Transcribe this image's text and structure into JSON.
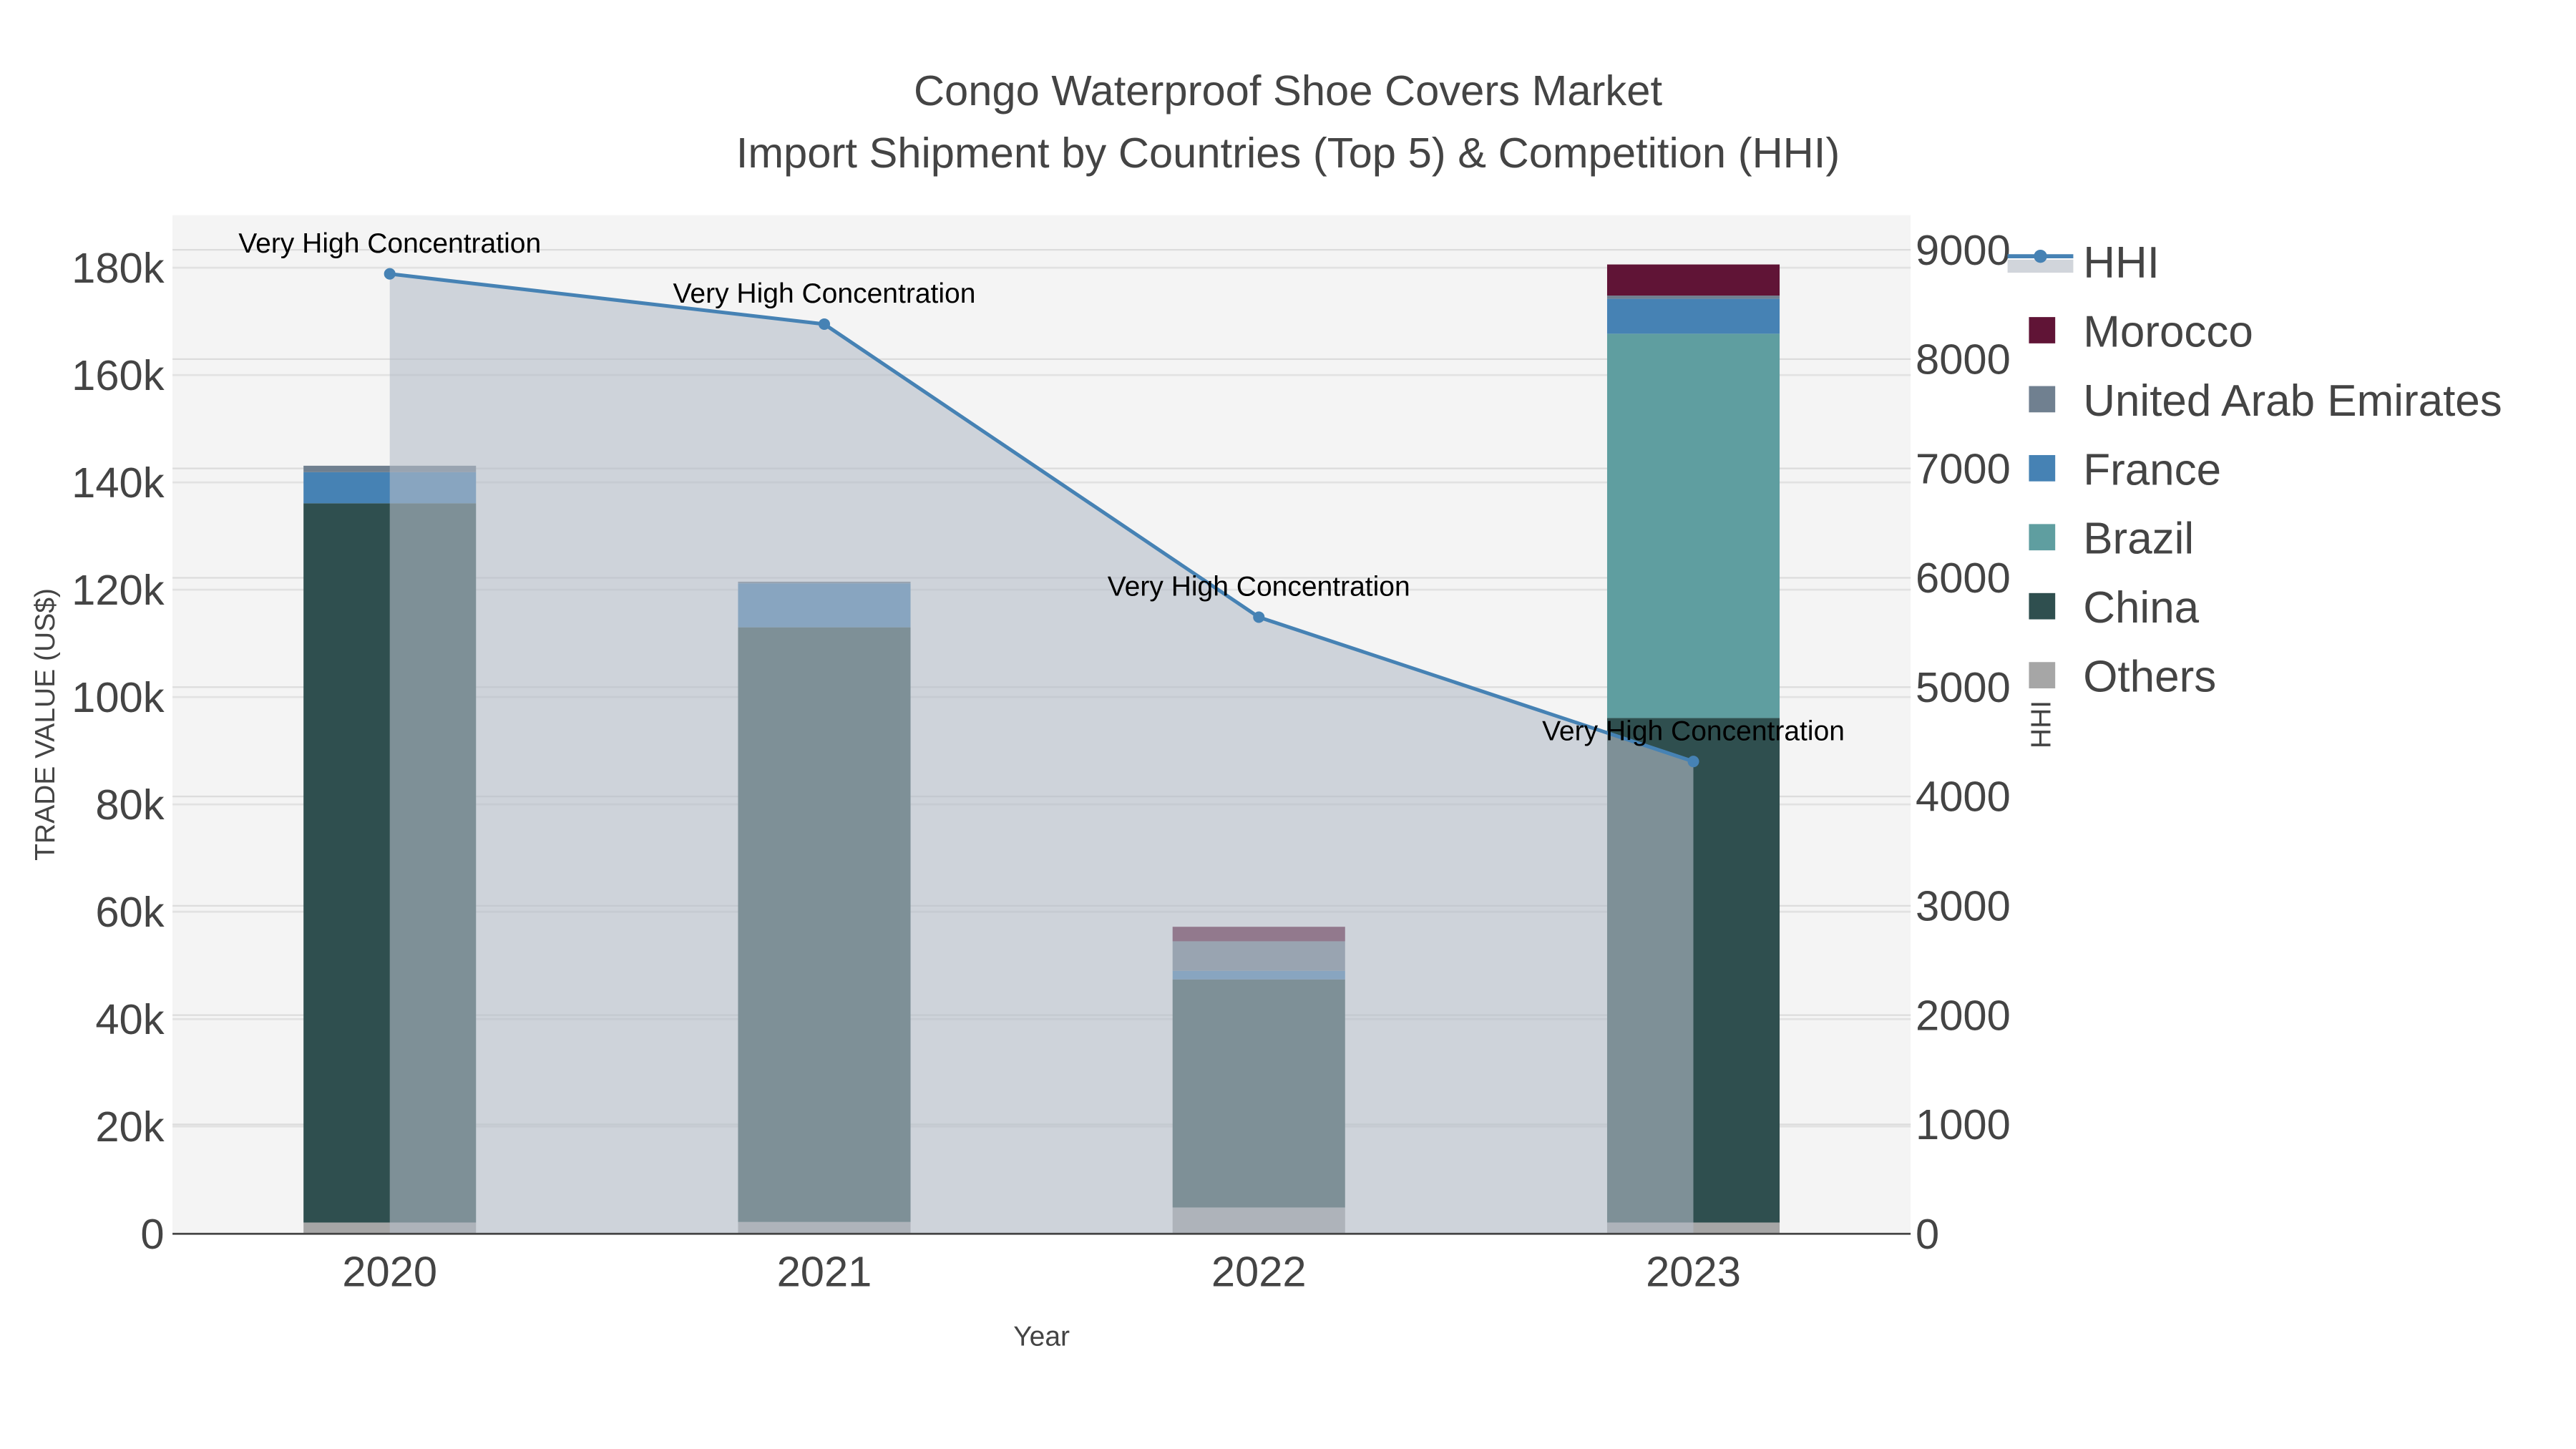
{
  "chart_data": {
    "type": "bar",
    "stacked": true,
    "title": "Congo Waterproof Shoe Covers Market",
    "subtitle": "Import Shipment by Countries (Top 5) & Competition (HHI)",
    "xlabel": "Year",
    "ylabel": "TRADE VALUE (US$)",
    "y2label": "HHI",
    "categories": [
      "2020",
      "2021",
      "2022",
      "2023"
    ],
    "ylim": [
      0,
      190000
    ],
    "y2lim": [
      0,
      9300
    ],
    "yticks": [
      0,
      20000,
      40000,
      60000,
      80000,
      100000,
      120000,
      140000,
      160000,
      180000
    ],
    "ytick_labels": [
      "0",
      "20k",
      "40k",
      "60k",
      "80k",
      "100k",
      "120k",
      "140k",
      "160k",
      "180k"
    ],
    "y2ticks": [
      0,
      1000,
      2000,
      3000,
      4000,
      5000,
      6000,
      7000,
      8000,
      9000
    ],
    "y2tick_labels": [
      "0",
      "1000",
      "2000",
      "3000",
      "4000",
      "5000",
      "6000",
      "7000",
      "8000",
      "9000"
    ],
    "series": [
      {
        "name": "Others",
        "color": "#a6a6a6",
        "values": [
          2100,
          2200,
          4900,
          2100
        ]
      },
      {
        "name": "China",
        "color": "#2f4f4f",
        "values": [
          134000,
          110800,
          42500,
          94000
        ]
      },
      {
        "name": "Brazil",
        "color": "#5f9ea0",
        "values": [
          0,
          0,
          0,
          71600
        ]
      },
      {
        "name": "France",
        "color": "#4682b4",
        "values": [
          5800,
          8200,
          1600,
          6500
        ]
      },
      {
        "name": "United Arab Emirates",
        "color": "#708090",
        "values": [
          1200,
          300,
          5500,
          600
        ]
      },
      {
        "name": "Morocco",
        "color": "#601436",
        "values": [
          0,
          0,
          2700,
          5800
        ]
      }
    ],
    "hhi": {
      "name": "HHI",
      "color": "#4682b4",
      "values": [
        8780,
        8320,
        5640,
        4320
      ],
      "annotations": [
        "Very High Concentration",
        "Very High Concentration",
        "Very High Concentration",
        "Very High Concentration"
      ]
    },
    "legend_order": [
      "HHI",
      "Morocco",
      "United Arab Emirates",
      "France",
      "Brazil",
      "China",
      "Others"
    ],
    "legend_placement": "right",
    "grid": true
  }
}
